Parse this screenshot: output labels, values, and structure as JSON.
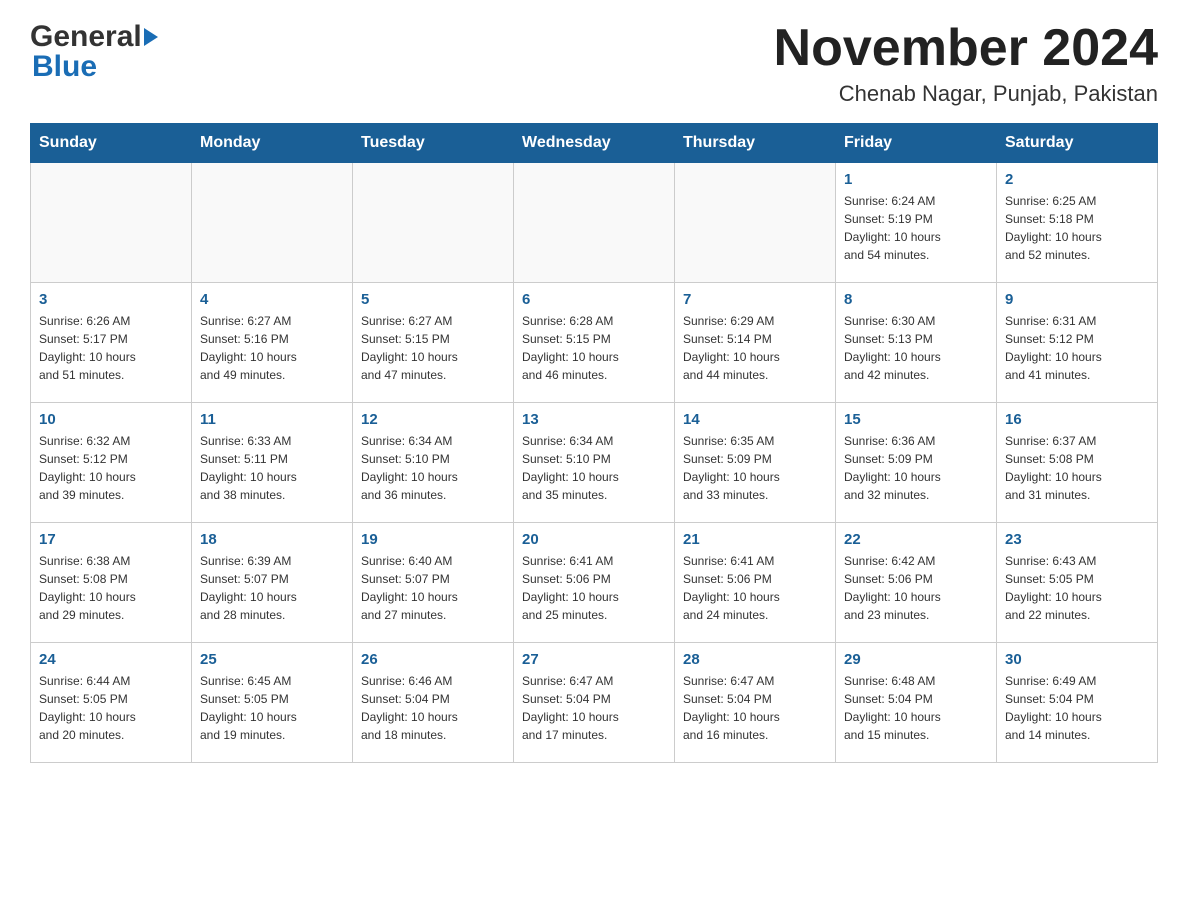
{
  "logo": {
    "general": "General",
    "blue": "Blue"
  },
  "title": "November 2024",
  "subtitle": "Chenab Nagar, Punjab, Pakistan",
  "headers": [
    "Sunday",
    "Monday",
    "Tuesday",
    "Wednesday",
    "Thursday",
    "Friday",
    "Saturday"
  ],
  "weeks": [
    [
      {
        "day": "",
        "info": ""
      },
      {
        "day": "",
        "info": ""
      },
      {
        "day": "",
        "info": ""
      },
      {
        "day": "",
        "info": ""
      },
      {
        "day": "",
        "info": ""
      },
      {
        "day": "1",
        "info": "Sunrise: 6:24 AM\nSunset: 5:19 PM\nDaylight: 10 hours\nand 54 minutes."
      },
      {
        "day": "2",
        "info": "Sunrise: 6:25 AM\nSunset: 5:18 PM\nDaylight: 10 hours\nand 52 minutes."
      }
    ],
    [
      {
        "day": "3",
        "info": "Sunrise: 6:26 AM\nSunset: 5:17 PM\nDaylight: 10 hours\nand 51 minutes."
      },
      {
        "day": "4",
        "info": "Sunrise: 6:27 AM\nSunset: 5:16 PM\nDaylight: 10 hours\nand 49 minutes."
      },
      {
        "day": "5",
        "info": "Sunrise: 6:27 AM\nSunset: 5:15 PM\nDaylight: 10 hours\nand 47 minutes."
      },
      {
        "day": "6",
        "info": "Sunrise: 6:28 AM\nSunset: 5:15 PM\nDaylight: 10 hours\nand 46 minutes."
      },
      {
        "day": "7",
        "info": "Sunrise: 6:29 AM\nSunset: 5:14 PM\nDaylight: 10 hours\nand 44 minutes."
      },
      {
        "day": "8",
        "info": "Sunrise: 6:30 AM\nSunset: 5:13 PM\nDaylight: 10 hours\nand 42 minutes."
      },
      {
        "day": "9",
        "info": "Sunrise: 6:31 AM\nSunset: 5:12 PM\nDaylight: 10 hours\nand 41 minutes."
      }
    ],
    [
      {
        "day": "10",
        "info": "Sunrise: 6:32 AM\nSunset: 5:12 PM\nDaylight: 10 hours\nand 39 minutes."
      },
      {
        "day": "11",
        "info": "Sunrise: 6:33 AM\nSunset: 5:11 PM\nDaylight: 10 hours\nand 38 minutes."
      },
      {
        "day": "12",
        "info": "Sunrise: 6:34 AM\nSunset: 5:10 PM\nDaylight: 10 hours\nand 36 minutes."
      },
      {
        "day": "13",
        "info": "Sunrise: 6:34 AM\nSunset: 5:10 PM\nDaylight: 10 hours\nand 35 minutes."
      },
      {
        "day": "14",
        "info": "Sunrise: 6:35 AM\nSunset: 5:09 PM\nDaylight: 10 hours\nand 33 minutes."
      },
      {
        "day": "15",
        "info": "Sunrise: 6:36 AM\nSunset: 5:09 PM\nDaylight: 10 hours\nand 32 minutes."
      },
      {
        "day": "16",
        "info": "Sunrise: 6:37 AM\nSunset: 5:08 PM\nDaylight: 10 hours\nand 31 minutes."
      }
    ],
    [
      {
        "day": "17",
        "info": "Sunrise: 6:38 AM\nSunset: 5:08 PM\nDaylight: 10 hours\nand 29 minutes."
      },
      {
        "day": "18",
        "info": "Sunrise: 6:39 AM\nSunset: 5:07 PM\nDaylight: 10 hours\nand 28 minutes."
      },
      {
        "day": "19",
        "info": "Sunrise: 6:40 AM\nSunset: 5:07 PM\nDaylight: 10 hours\nand 27 minutes."
      },
      {
        "day": "20",
        "info": "Sunrise: 6:41 AM\nSunset: 5:06 PM\nDaylight: 10 hours\nand 25 minutes."
      },
      {
        "day": "21",
        "info": "Sunrise: 6:41 AM\nSunset: 5:06 PM\nDaylight: 10 hours\nand 24 minutes."
      },
      {
        "day": "22",
        "info": "Sunrise: 6:42 AM\nSunset: 5:06 PM\nDaylight: 10 hours\nand 23 minutes."
      },
      {
        "day": "23",
        "info": "Sunrise: 6:43 AM\nSunset: 5:05 PM\nDaylight: 10 hours\nand 22 minutes."
      }
    ],
    [
      {
        "day": "24",
        "info": "Sunrise: 6:44 AM\nSunset: 5:05 PM\nDaylight: 10 hours\nand 20 minutes."
      },
      {
        "day": "25",
        "info": "Sunrise: 6:45 AM\nSunset: 5:05 PM\nDaylight: 10 hours\nand 19 minutes."
      },
      {
        "day": "26",
        "info": "Sunrise: 6:46 AM\nSunset: 5:04 PM\nDaylight: 10 hours\nand 18 minutes."
      },
      {
        "day": "27",
        "info": "Sunrise: 6:47 AM\nSunset: 5:04 PM\nDaylight: 10 hours\nand 17 minutes."
      },
      {
        "day": "28",
        "info": "Sunrise: 6:47 AM\nSunset: 5:04 PM\nDaylight: 10 hours\nand 16 minutes."
      },
      {
        "day": "29",
        "info": "Sunrise: 6:48 AM\nSunset: 5:04 PM\nDaylight: 10 hours\nand 15 minutes."
      },
      {
        "day": "30",
        "info": "Sunrise: 6:49 AM\nSunset: 5:04 PM\nDaylight: 10 hours\nand 14 minutes."
      }
    ]
  ]
}
